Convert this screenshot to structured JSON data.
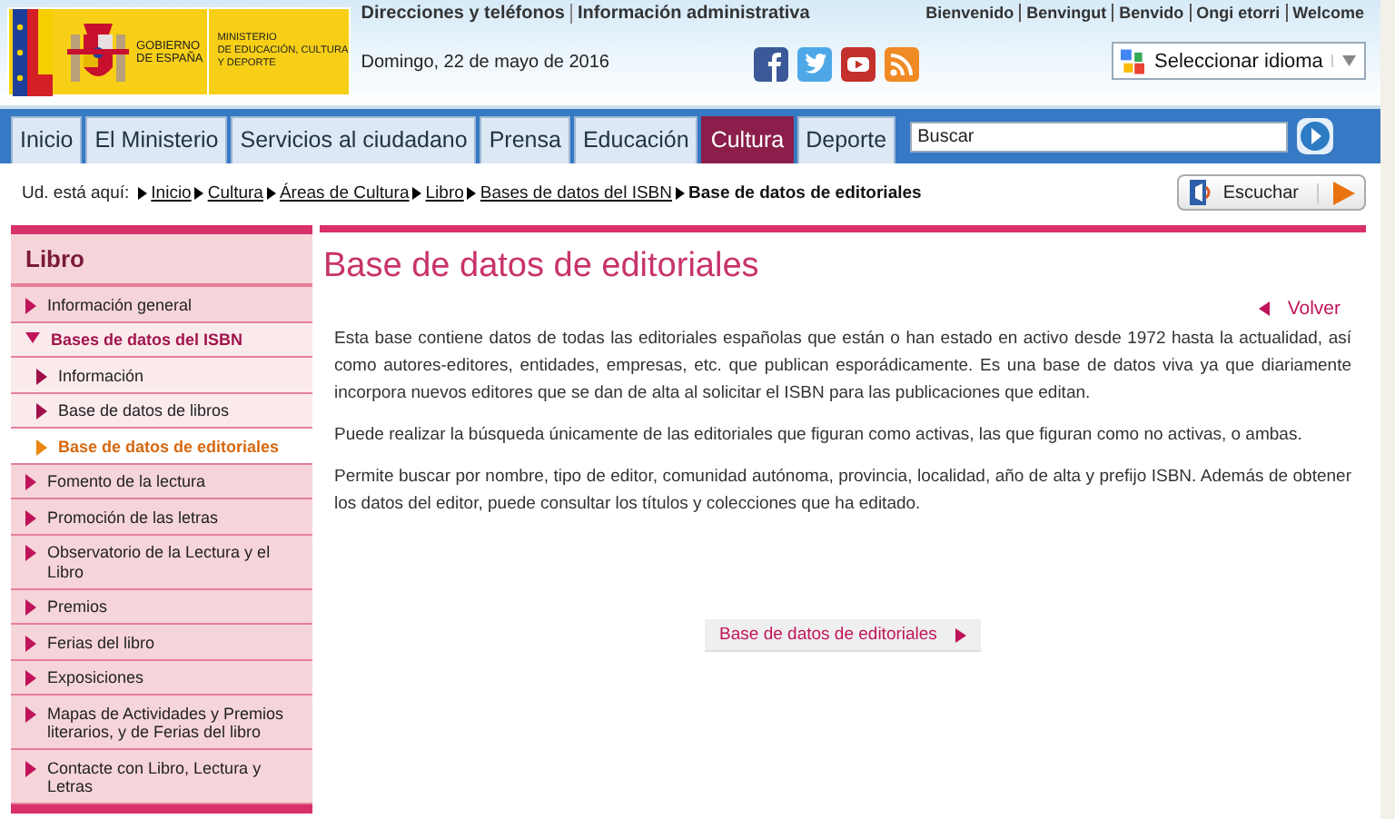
{
  "header": {
    "logo": {
      "government_lines": [
        "GOBIERNO",
        "DE ESPAÑA"
      ],
      "ministry_lines": [
        "MINISTERIO",
        "DE EDUCACIÓN, CULTURA",
        "Y DEPORTE"
      ]
    },
    "top_links": [
      "Direcciones y teléfonos",
      "Información administrativa"
    ],
    "date": "Domingo, 22 de mayo de 2016",
    "welcome_links": [
      "Bienvenido",
      "Benvingut",
      "Benvido",
      "Ongi etorri",
      "Welcome"
    ],
    "social": [
      {
        "kind": "facebook"
      },
      {
        "kind": "twitter"
      },
      {
        "kind": "youtube"
      },
      {
        "kind": "rss"
      }
    ],
    "language_selector": "Seleccionar idioma"
  },
  "nav": {
    "tabs": [
      {
        "label": "Inicio",
        "selected": false
      },
      {
        "label": "El Ministerio",
        "selected": false
      },
      {
        "label": "Servicios al ciudadano",
        "selected": false
      },
      {
        "label": "Prensa",
        "selected": false
      },
      {
        "label": "Educación",
        "selected": false
      },
      {
        "label": "Cultura",
        "selected": true
      },
      {
        "label": "Deporte",
        "selected": false
      }
    ],
    "search": {
      "placeholder": "Buscar"
    }
  },
  "breadcrumb": {
    "label": "Ud. está aquí:",
    "items": [
      {
        "text": "Inicio",
        "current": false
      },
      {
        "text": "Cultura",
        "current": false
      },
      {
        "text": "Áreas de Cultura",
        "current": false
      },
      {
        "text": "Libro",
        "current": false
      },
      {
        "text": "Bases de datos del ISBN",
        "current": false
      },
      {
        "text": "Base de datos de editoriales",
        "current": true
      }
    ],
    "listen_button": "Escuchar"
  },
  "sidebar": {
    "title": "Libro",
    "items": [
      {
        "label": "Información general",
        "expanded": false
      },
      {
        "label": "Bases de datos del ISBN",
        "expanded": true,
        "children": [
          {
            "label": "Información",
            "selected": false
          },
          {
            "label": "Base de datos de libros",
            "selected": false
          },
          {
            "label": "Base de datos de editoriales",
            "selected": true
          }
        ]
      },
      {
        "label": "Fomento de la lectura",
        "expanded": false
      },
      {
        "label": "Promoción de las letras",
        "expanded": false
      },
      {
        "label": "Observatorio de la Lectura y el Libro",
        "expanded": false
      },
      {
        "label": "Premios",
        "expanded": false
      },
      {
        "label": "Ferias del libro",
        "expanded": false
      },
      {
        "label": "Exposiciones",
        "expanded": false
      },
      {
        "label": "Mapas de Actividades y Premios literarios, y de Ferias del libro",
        "expanded": false
      },
      {
        "label": "Contacte con Libro, Lectura y Letras",
        "expanded": false
      }
    ]
  },
  "main": {
    "title": "Base de datos de editoriales",
    "back_link": "Volver",
    "paragraphs": [
      "Esta base contiene datos de todas las editoriales españolas que están o han estado en activo desde 1972 hasta la actualidad, así como autores-editores, entidades, empresas, etc. que publican esporádicamente. Es una base de datos viva ya que diariamente incorpora nuevos editores que se dan de alta al solicitar el ISBN para las publicaciones que editan.",
      "Puede realizar la búsqueda únicamente de las editoriales que figuran como activas, las que figuran como no activas, o ambas.",
      "Permite buscar por nombre, tipo de editor, comunidad autónoma, provincia, localidad, año de alta y prefijo ISBN. Además de obtener los datos del editor, puede consultar los títulos y colecciones que ha editado."
    ],
    "link_button": "Base de datos de editoriales"
  }
}
